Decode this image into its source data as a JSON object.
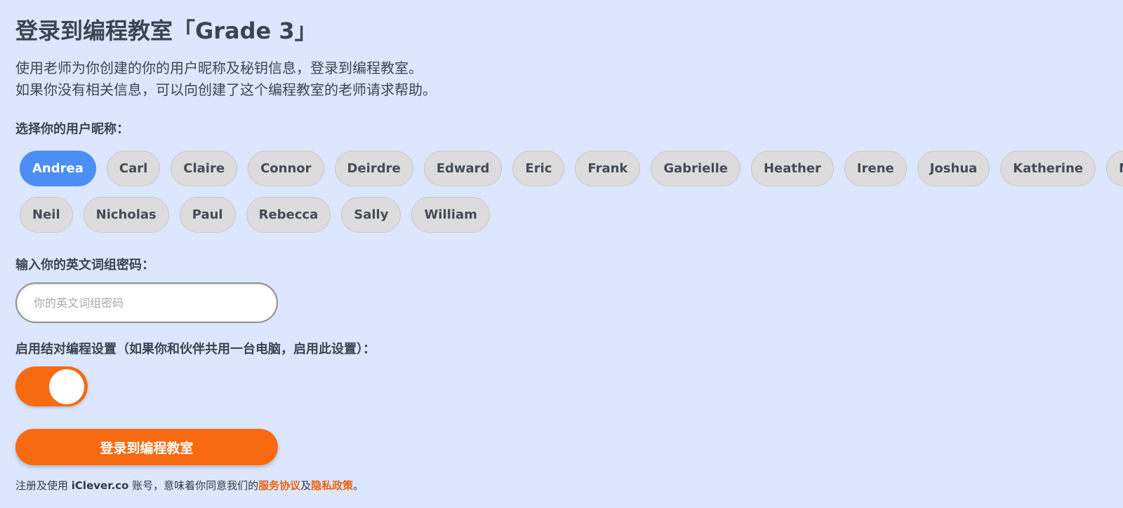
{
  "header": {
    "title": "登录到编程教室「Grade 3」"
  },
  "intro": {
    "line1": "使用老师为你创建的你的用户昵称及秘钥信息，登录到编程教室。",
    "line2": "如果你没有相关信息，可以向创建了这个编程教室的老师请求帮助。"
  },
  "user_select": {
    "label": "选择你的用户昵称：",
    "selected": "Andrea",
    "names_row1": [
      "Andrea",
      "Carl",
      "Claire",
      "Connor",
      "Deirdre",
      "Edward",
      "Eric",
      "Frank",
      "Gabrielle",
      "Heather",
      "Irene",
      "Joshua",
      "Katherine",
      "Max"
    ],
    "names_row2": [
      "Neil",
      "Nicholas",
      "Paul",
      "Rebecca",
      "Sally",
      "William"
    ]
  },
  "password": {
    "label": "输入你的英文词组密码：",
    "placeholder": "你的英文词组密码",
    "value": ""
  },
  "pair_programming": {
    "label": "启用结对编程设置（如果你和伙伴共用一台电脑，启用此设置）：",
    "enabled": true
  },
  "login_button": {
    "label": "登录到编程教室"
  },
  "footer": {
    "prefix": "注册及使用 ",
    "brand": "iClever.co",
    "middle": " 账号，意味着你同意我们的",
    "terms_link": "服务协议",
    "and": "及",
    "privacy_link": "隐私政策",
    "suffix": "。"
  },
  "colors": {
    "background": "#dce6ff",
    "accent_orange": "#f86a12",
    "selected_blue": "#4b8ef5",
    "pill_gray": "#dcdcdc"
  }
}
